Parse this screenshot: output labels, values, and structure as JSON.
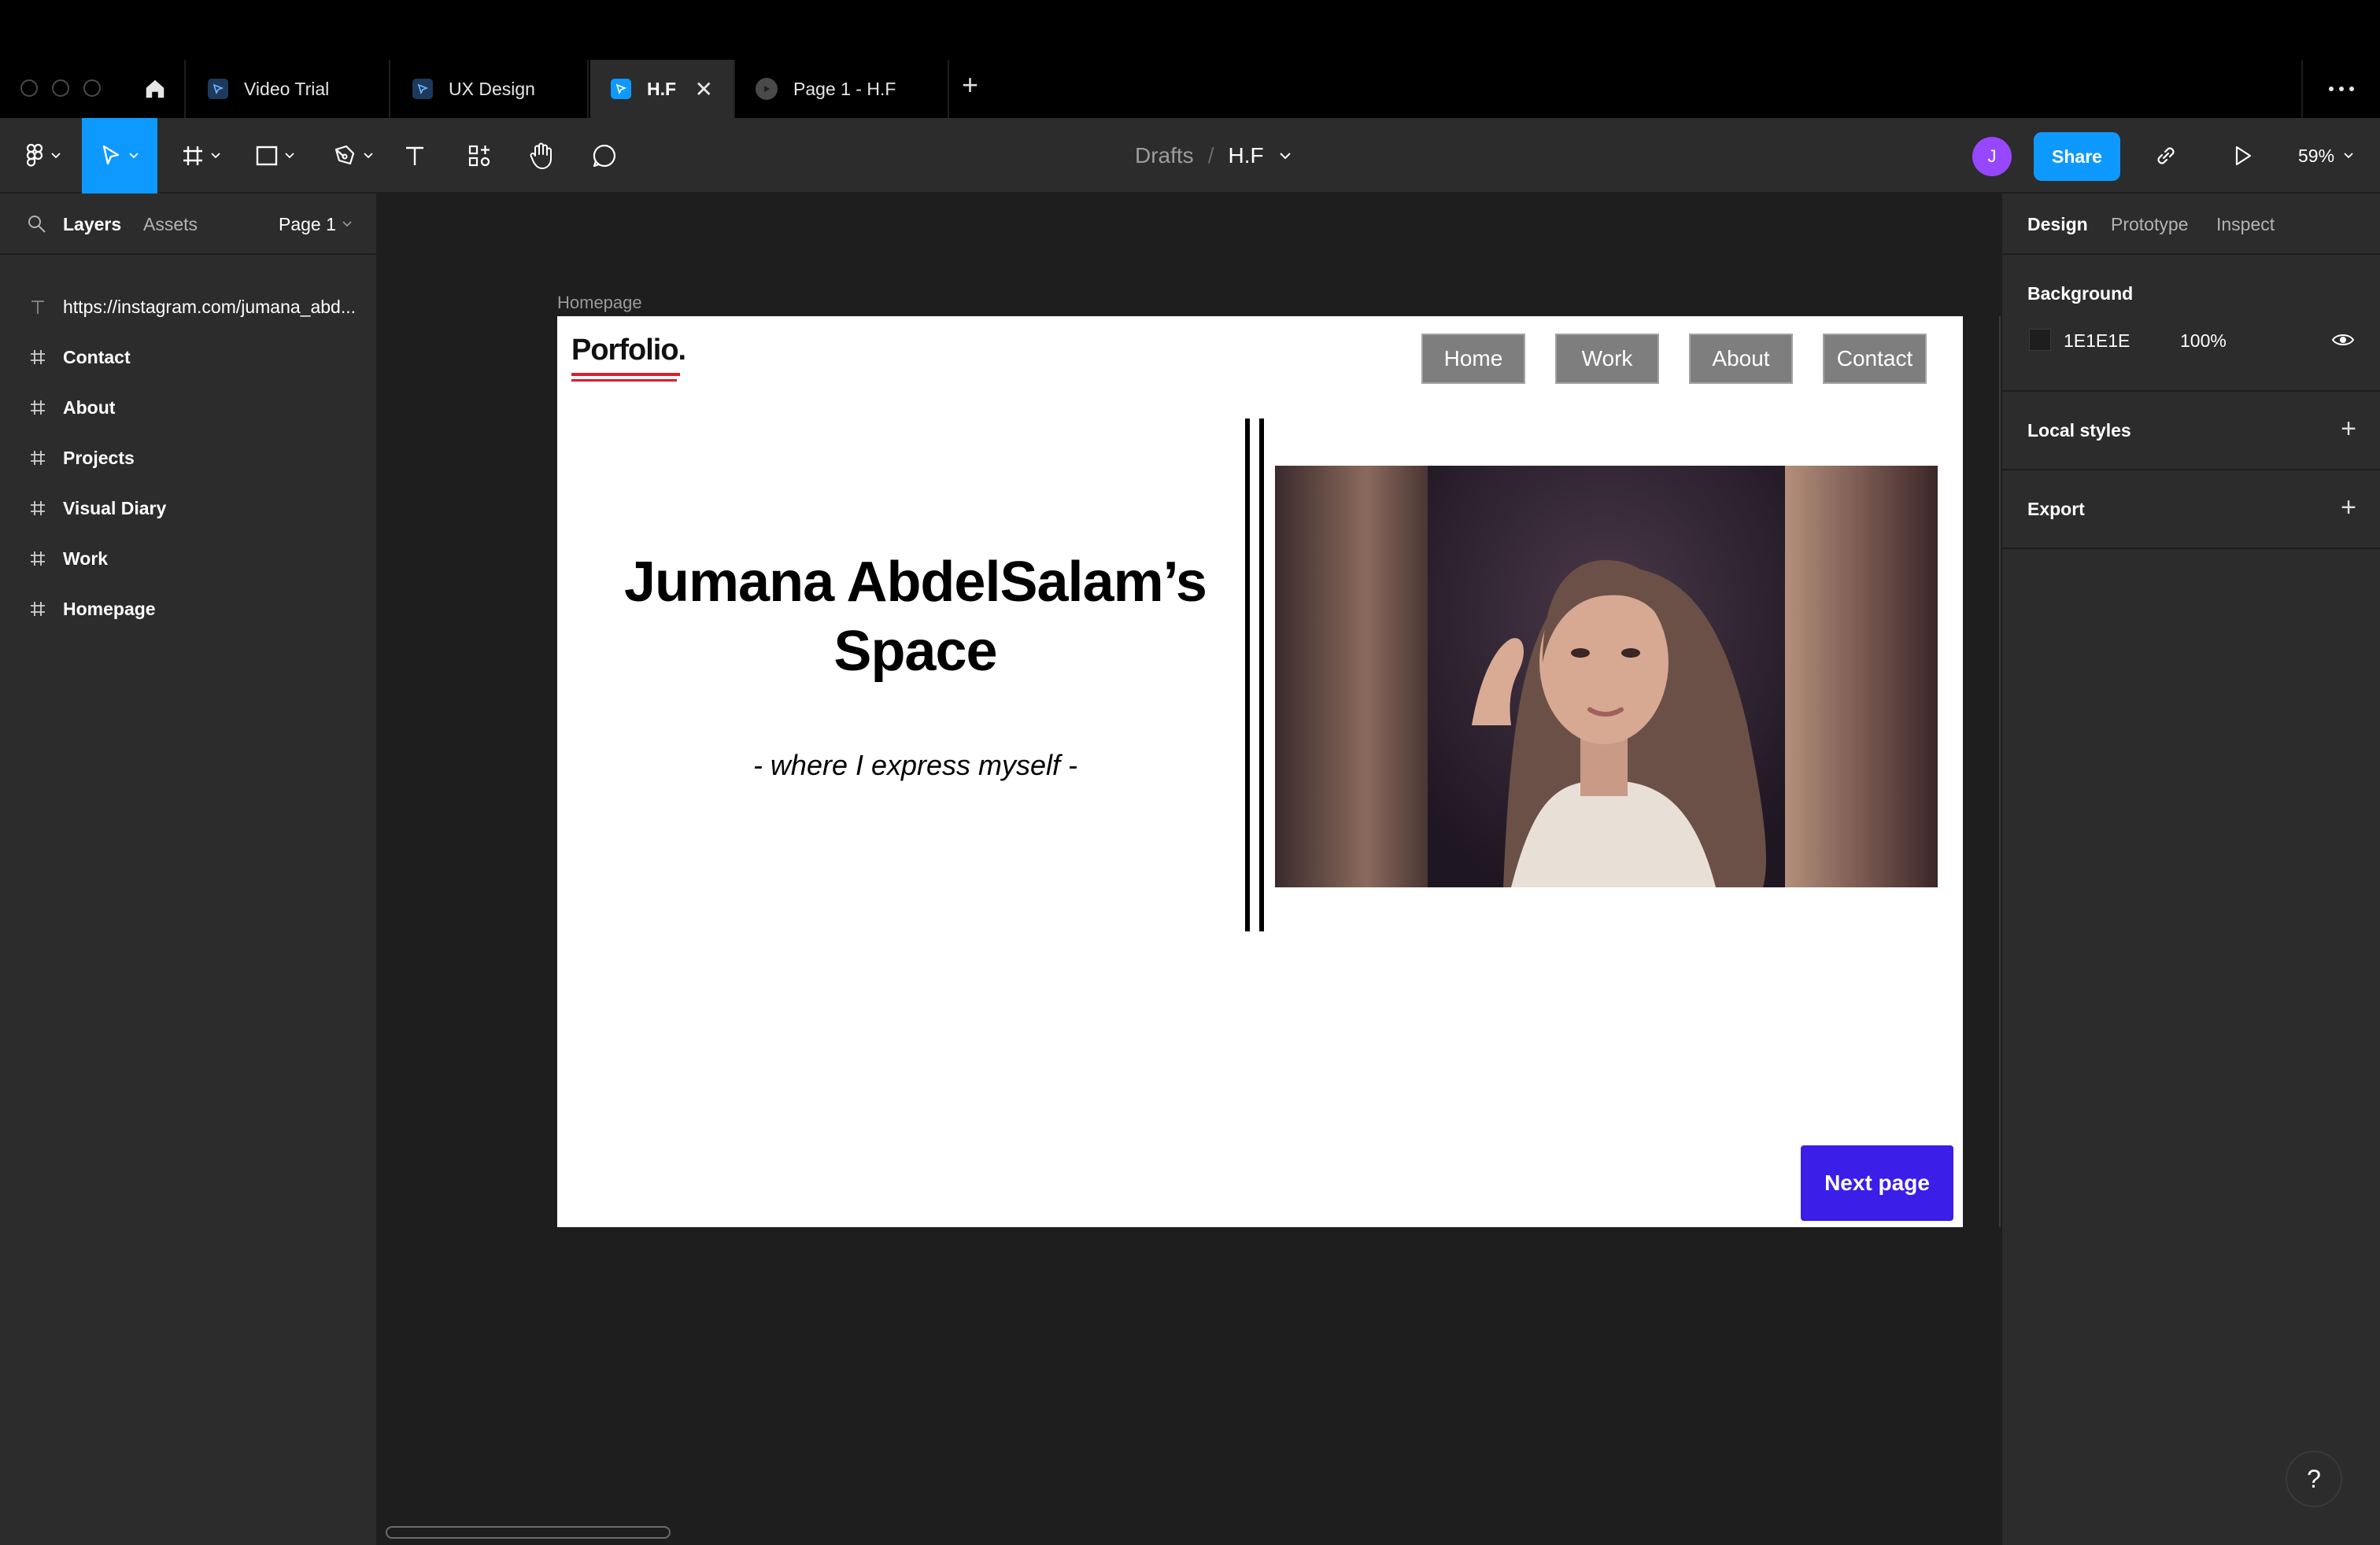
{
  "tabs": [
    {
      "label": "Video Trial",
      "active": false
    },
    {
      "label": "UX Design",
      "active": false
    },
    {
      "label": "H.F",
      "active": true
    },
    {
      "label": "Page 1 - H.F",
      "active": false
    }
  ],
  "breadcrumb": {
    "parent": "Drafts",
    "separator": "/",
    "file": "H.F"
  },
  "toolbar": {
    "avatar_initial": "J",
    "share_label": "Share",
    "zoom": "59%",
    "tools": [
      "main-menu",
      "move",
      "frame",
      "shape",
      "pen",
      "text",
      "resources",
      "hand",
      "comment"
    ]
  },
  "left_panel": {
    "tabs": {
      "layers": "Layers",
      "assets": "Assets",
      "page": "Page 1"
    },
    "layers": [
      {
        "type": "text",
        "name": "https://instagram.com/jumana_abd..."
      },
      {
        "type": "frame",
        "name": "Contact"
      },
      {
        "type": "frame",
        "name": "About"
      },
      {
        "type": "frame",
        "name": "Projects"
      },
      {
        "type": "frame",
        "name": "Visual Diary"
      },
      {
        "type": "frame",
        "name": "Work"
      },
      {
        "type": "frame",
        "name": "Homepage"
      }
    ]
  },
  "canvas": {
    "frame_label": "Homepage",
    "background": "#1E1E1E",
    "design": {
      "logo": "Porfolio.",
      "nav": [
        "Home",
        "Work",
        "About",
        "Contact"
      ],
      "title_line1": "Jumana AbdelSalam’s",
      "title_line2": "Space",
      "subtitle": "-  where I express myself  -",
      "next_button": "Next page",
      "accent_color": "#3B1EE8",
      "underline_color": "#E01B2C"
    }
  },
  "right_panel": {
    "tabs": {
      "design": "Design",
      "prototype": "Prototype",
      "inspect": "Inspect"
    },
    "background": {
      "heading": "Background",
      "hex": "1E1E1E",
      "opacity": "100%"
    },
    "local_styles": "Local styles",
    "export": "Export"
  },
  "help": "?"
}
